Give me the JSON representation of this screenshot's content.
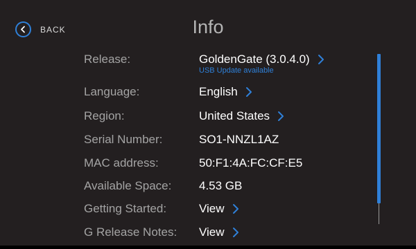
{
  "header": {
    "back_label": "BACK",
    "title": "Info"
  },
  "rows": [
    {
      "label": "Release:",
      "value": "GoldenGate (3.0.4.0)",
      "sub": "USB Update available",
      "has_chevron": true
    },
    {
      "label": "Language:",
      "value": "English",
      "has_chevron": true
    },
    {
      "label": "Region:",
      "value": "United States",
      "has_chevron": true
    },
    {
      "label": "Serial Number:",
      "value": "SO1-NNZL1AZ",
      "has_chevron": false
    },
    {
      "label": "MAC address:",
      "value": "50:F1:4A:FC:CF:E5",
      "has_chevron": false
    },
    {
      "label": "Available Space:",
      "value": "4.53 GB",
      "has_chevron": false
    },
    {
      "label": "Getting Started:",
      "value": "View",
      "has_chevron": true
    },
    {
      "label": "G Release Notes:",
      "value": "View",
      "has_chevron": true
    }
  ],
  "icons": {
    "back": "chevron-left-in-circle",
    "row_action": "chevron-right"
  },
  "scrollbar": {
    "visible_fraction": 0.88,
    "position_fraction": 0.0
  },
  "colors": {
    "background": "#231f20",
    "accent": "#2f80d8",
    "label": "#a4a4a4",
    "value": "#ffffff"
  }
}
